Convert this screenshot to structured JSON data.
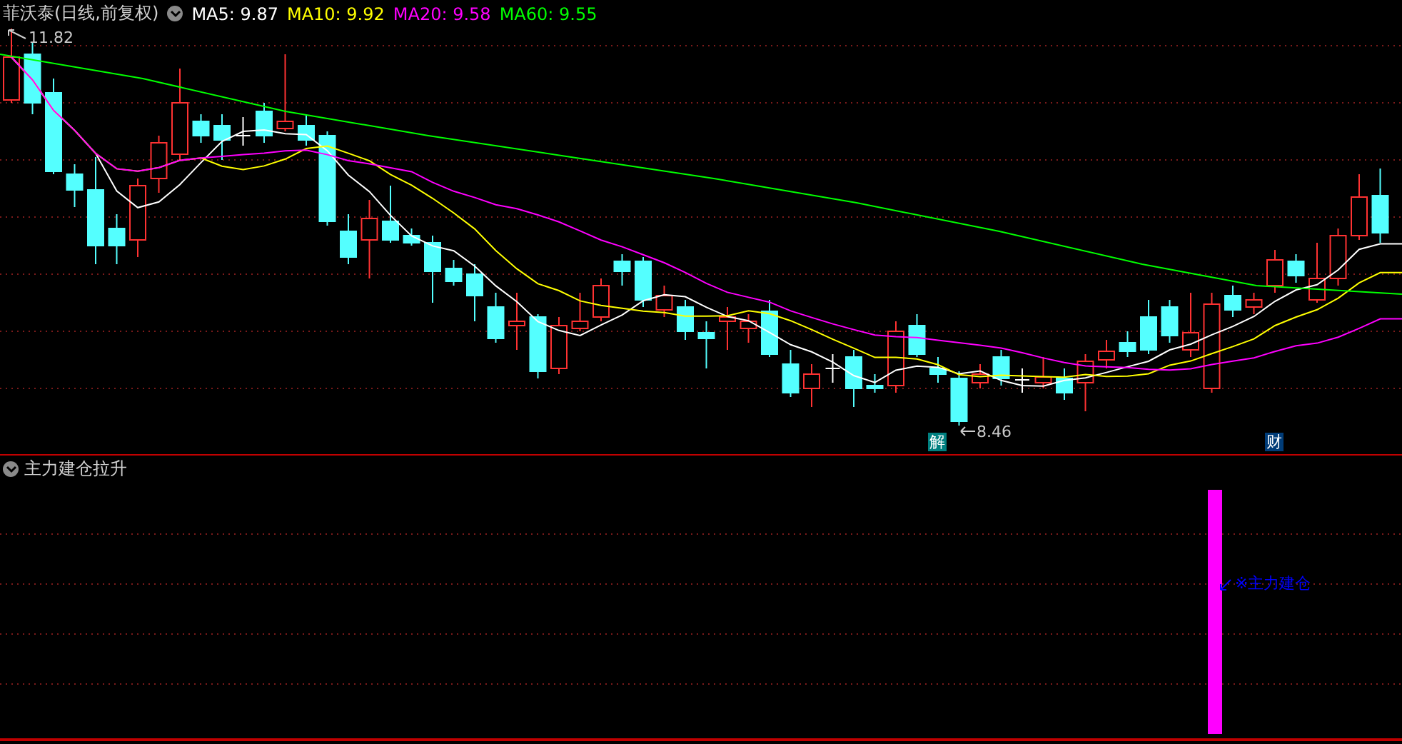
{
  "chart": {
    "title": "菲沃泰(日线,前复权)",
    "ma_legend": [
      {
        "label": "MA5: 9.87",
        "color": "#ffffff"
      },
      {
        "label": "MA10: 9.92",
        "color": "#ffff00"
      },
      {
        "label": "MA20: 9.58",
        "color": "#ff00ff"
      },
      {
        "label": "MA60: 9.55",
        "color": "#00ff00"
      }
    ],
    "high_label": "11.82",
    "low_label": "8.46",
    "markers": [
      {
        "text": "解",
        "color": "#008080"
      },
      {
        "text": "财",
        "color": "#003c78"
      }
    ]
  },
  "indicator": {
    "title": "主力建仓拉升",
    "annotation": "※主力建仓"
  }
}
